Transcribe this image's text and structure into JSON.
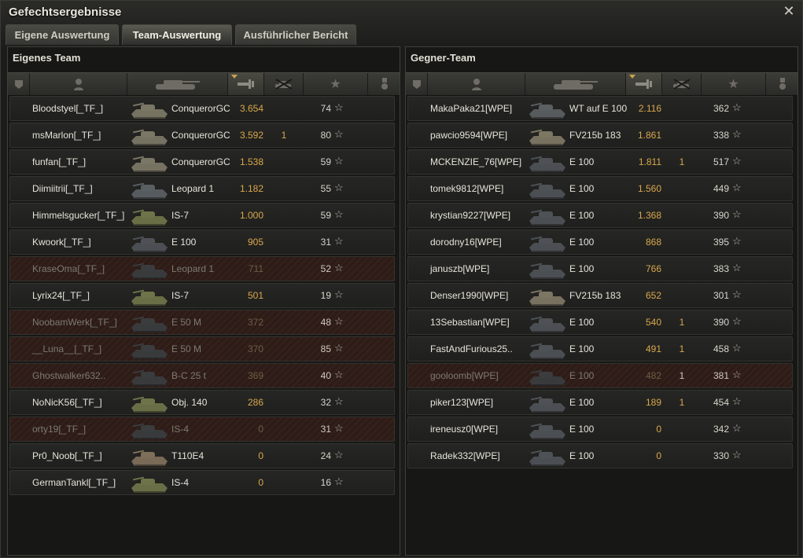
{
  "window": {
    "title": "Gefechtsergebnisse"
  },
  "tabs": [
    {
      "label": "Eigene Auswertung",
      "active": false
    },
    {
      "label": "Team-Auswertung",
      "active": true
    },
    {
      "label": "Ausführlicher Bericht",
      "active": false
    }
  ],
  "columns": [
    {
      "icon": "squad-icon"
    },
    {
      "icon": "player-icon"
    },
    {
      "icon": "tank-icon"
    },
    {
      "icon": "damage-icon",
      "sorted": true
    },
    {
      "icon": "kills-icon"
    },
    {
      "icon": "xp-star-icon"
    },
    {
      "icon": "medal-icon"
    }
  ],
  "colors": {
    "damage": "#d9a84c",
    "destroyed_row": "#2c1b17"
  },
  "own_team": {
    "title": "Eigenes Team",
    "players": [
      {
        "name": "Bloodstyel[_TF_]",
        "tank": "ConquerorGC",
        "damage": "3.654",
        "kills": "",
        "xp": "74",
        "destroyed": false,
        "camo": "#7b7765"
      },
      {
        "name": "msMarlon[_TF_]",
        "tank": "ConquerorGC",
        "damage": "3.592",
        "kills": "1",
        "xp": "80",
        "destroyed": false,
        "camo": "#7b7765"
      },
      {
        "name": "funfan[_TF_]",
        "tank": "ConquerorGC",
        "damage": "1.538",
        "kills": "",
        "xp": "59",
        "destroyed": false,
        "camo": "#7b7765"
      },
      {
        "name": "Diimiitrii[_TF_]",
        "tank": "Leopard 1",
        "damage": "1.182",
        "kills": "",
        "xp": "55",
        "destroyed": false,
        "camo": "#5a5f63"
      },
      {
        "name": "Himmelsgucker[_TF_]",
        "tank": "IS-7",
        "damage": "1.000",
        "kills": "",
        "xp": "59",
        "destroyed": false,
        "camo": "#6f7349"
      },
      {
        "name": "Kwoork[_TF_]",
        "tank": "E 100",
        "damage": "905",
        "kills": "",
        "xp": "31",
        "destroyed": false,
        "camo": "#4e5256"
      },
      {
        "name": "KraseOma[_TF_]",
        "tank": "Leopard 1",
        "damage": "711",
        "kills": "",
        "xp": "52",
        "destroyed": true,
        "camo": "#3a3c3e"
      },
      {
        "name": "Lyrix24[_TF_]",
        "tank": "IS-7",
        "damage": "501",
        "kills": "",
        "xp": "19",
        "destroyed": false,
        "camo": "#6f7349"
      },
      {
        "name": "NoobamWerk[_TF_]",
        "tank": "E 50 M",
        "damage": "372",
        "kills": "",
        "xp": "48",
        "destroyed": true,
        "camo": "#3a3c3e"
      },
      {
        "name": "__Luna__[_TF_]",
        "tank": "E 50 M",
        "damage": "370",
        "kills": "",
        "xp": "85",
        "destroyed": true,
        "camo": "#3a3c3e"
      },
      {
        "name": "Ghostwalker632..",
        "tank": "B-C 25 t",
        "damage": "369",
        "kills": "",
        "xp": "40",
        "destroyed": true,
        "camo": "#3a3c3e"
      },
      {
        "name": "NoNicK56[_TF_]",
        "tank": "Obj. 140",
        "damage": "286",
        "kills": "",
        "xp": "32",
        "destroyed": false,
        "camo": "#6f7349"
      },
      {
        "name": "orty19[_TF_]",
        "tank": "IS-4",
        "damage": "0",
        "kills": "",
        "xp": "31",
        "destroyed": true,
        "camo": "#3a3c3e"
      },
      {
        "name": "Pr0_Noob[_TF_]",
        "tank": "T110E4",
        "damage": "0",
        "kills": "",
        "xp": "24",
        "destroyed": false,
        "camo": "#7d6f5a"
      },
      {
        "name": "GermanTankl[_TF_]",
        "tank": "IS-4",
        "damage": "0",
        "kills": "",
        "xp": "16",
        "destroyed": false,
        "camo": "#6f7349"
      }
    ]
  },
  "enemy_team": {
    "title": "Gegner-Team",
    "players": [
      {
        "name": "MakaPaka21[WPE]",
        "tank": "WT auf E 100",
        "damage": "2.116",
        "kills": "",
        "xp": "362",
        "destroyed": false,
        "camo": "#5b5f62"
      },
      {
        "name": "pawcio9594[WPE]",
        "tank": "FV215b 183",
        "damage": "1.861",
        "kills": "",
        "xp": "338",
        "destroyed": false,
        "camo": "#7d7663"
      },
      {
        "name": "MCKENZIE_76[WPE]",
        "tank": "E 100",
        "damage": "1.811",
        "kills": "1",
        "xp": "517",
        "destroyed": false,
        "camo": "#4e5256"
      },
      {
        "name": "tomek9812[WPE]",
        "tank": "E 100",
        "damage": "1.560",
        "kills": "",
        "xp": "449",
        "destroyed": false,
        "camo": "#4e5256"
      },
      {
        "name": "krystian9227[WPE]",
        "tank": "E 100",
        "damage": "1.368",
        "kills": "",
        "xp": "390",
        "destroyed": false,
        "camo": "#4e5256"
      },
      {
        "name": "dorodny16[WPE]",
        "tank": "E 100",
        "damage": "868",
        "kills": "",
        "xp": "395",
        "destroyed": false,
        "camo": "#4e5256"
      },
      {
        "name": "januszb[WPE]",
        "tank": "E 100",
        "damage": "766",
        "kills": "",
        "xp": "383",
        "destroyed": false,
        "camo": "#4e5256"
      },
      {
        "name": "Denser1990[WPE]",
        "tank": "FV215b 183",
        "damage": "652",
        "kills": "",
        "xp": "301",
        "destroyed": false,
        "camo": "#7d7663"
      },
      {
        "name": "13Sebastian[WPE]",
        "tank": "E 100",
        "damage": "540",
        "kills": "1",
        "xp": "390",
        "destroyed": false,
        "camo": "#4e5256"
      },
      {
        "name": "FastAndFurious25..",
        "tank": "E 100",
        "damage": "491",
        "kills": "1",
        "xp": "458",
        "destroyed": false,
        "camo": "#4e5256"
      },
      {
        "name": "gooloomb[WPE]",
        "tank": "E 100",
        "damage": "482",
        "kills": "1",
        "xp": "381",
        "destroyed": true,
        "camo": "#3a3c3e"
      },
      {
        "name": "piker123[WPE]",
        "tank": "E 100",
        "damage": "189",
        "kills": "1",
        "xp": "454",
        "destroyed": false,
        "camo": "#4e5256"
      },
      {
        "name": "ireneusz0[WPE]",
        "tank": "E 100",
        "damage": "0",
        "kills": "",
        "xp": "342",
        "destroyed": false,
        "camo": "#4e5256"
      },
      {
        "name": "Radek332[WPE]",
        "tank": "E 100",
        "damage": "0",
        "kills": "",
        "xp": "330",
        "destroyed": false,
        "camo": "#4e5256"
      }
    ]
  }
}
